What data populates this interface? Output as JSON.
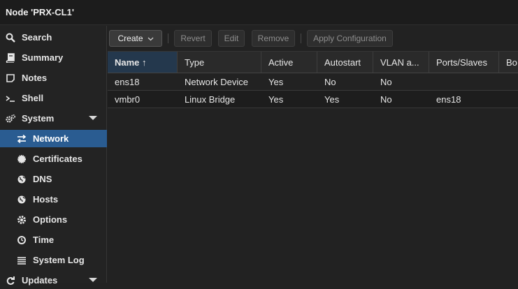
{
  "window": {
    "title": "Node 'PRX-CL1'"
  },
  "sidebar": {
    "items": [
      {
        "label": "Search",
        "icon": "search-icon"
      },
      {
        "label": "Summary",
        "icon": "book-icon"
      },
      {
        "label": "Notes",
        "icon": "note-icon"
      },
      {
        "label": "Shell",
        "icon": "terminal-icon"
      },
      {
        "label": "System",
        "icon": "gears-icon",
        "expanded": true
      },
      {
        "label": "Network",
        "icon": "exchange-icon",
        "selected": true
      },
      {
        "label": "Certificates",
        "icon": "certificate-icon"
      },
      {
        "label": "DNS",
        "icon": "globe-icon"
      },
      {
        "label": "Hosts",
        "icon": "globe-icon"
      },
      {
        "label": "Options",
        "icon": "gear-icon"
      },
      {
        "label": "Time",
        "icon": "clock-icon"
      },
      {
        "label": "System Log",
        "icon": "list-icon"
      },
      {
        "label": "Updates",
        "icon": "refresh-icon",
        "expanded": false
      }
    ]
  },
  "toolbar": {
    "create_label": "Create",
    "revert_label": "Revert",
    "edit_label": "Edit",
    "remove_label": "Remove",
    "apply_label": "Apply Configuration"
  },
  "grid": {
    "columns": [
      "Name ↑",
      "Type",
      "Active",
      "Autostart",
      "VLAN a...",
      "Ports/Slaves",
      "Bo"
    ],
    "rows": [
      [
        "ens18",
        "Network Device",
        "Yes",
        "No",
        "No",
        "",
        ""
      ],
      [
        "vmbr0",
        "Linux Bridge",
        "Yes",
        "Yes",
        "No",
        "ens18",
        ""
      ]
    ]
  },
  "colors": {
    "selection": "#2a5c91",
    "sorted_header": "#24384d",
    "background": "#222222"
  }
}
